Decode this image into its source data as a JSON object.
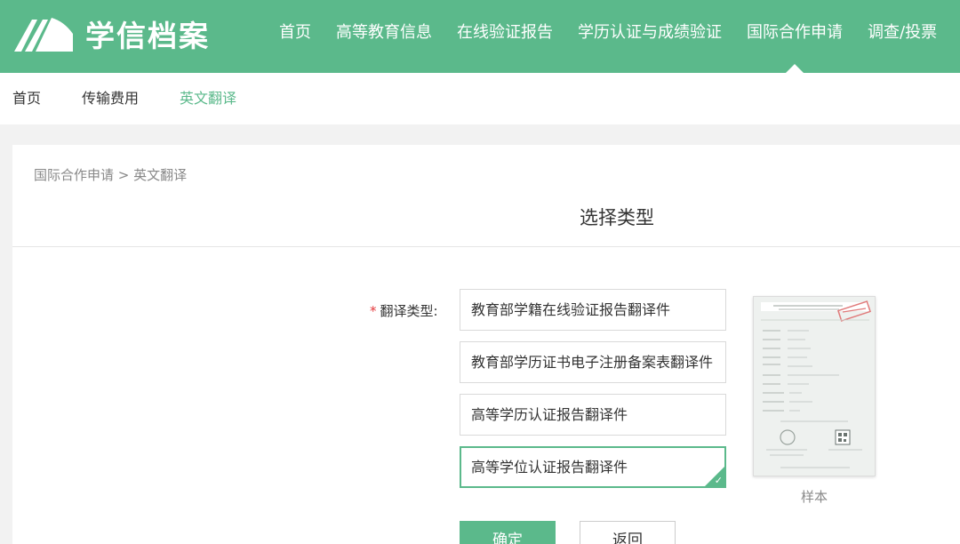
{
  "header": {
    "logo_text": "学信档案",
    "nav": [
      {
        "label": "首页"
      },
      {
        "label": "高等教育信息"
      },
      {
        "label": "在线验证报告"
      },
      {
        "label": "学历认证与成绩验证"
      },
      {
        "label": "国际合作申请",
        "active": true
      },
      {
        "label": "调查/投票"
      }
    ]
  },
  "subnav": [
    {
      "label": "首页"
    },
    {
      "label": "传输费用"
    },
    {
      "label": "英文翻译",
      "active": true
    }
  ],
  "breadcrumb": "国际合作申请 > 英文翻译",
  "page_title": "选择类型",
  "form": {
    "required_mark": "*",
    "label": "翻译类型:",
    "options": [
      {
        "label": "教育部学籍在线验证报告翻译件",
        "selected": false
      },
      {
        "label": "教育部学历证书电子注册备案表翻译件",
        "selected": false
      },
      {
        "label": "高等学历认证报告翻译件",
        "selected": false
      },
      {
        "label": "高等学位认证报告翻译件",
        "selected": true
      }
    ],
    "check_mark": "✓"
  },
  "sample": {
    "label": "样本"
  },
  "buttons": {
    "confirm": "确定",
    "back": "返回"
  },
  "colors": {
    "brand": "#5bb98b",
    "required": "#e4393c"
  }
}
